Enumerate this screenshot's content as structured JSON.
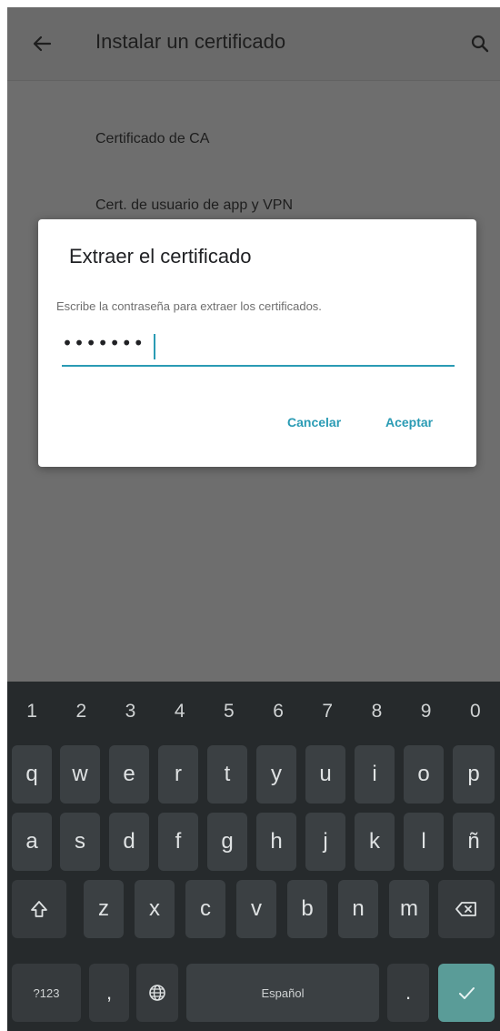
{
  "appbar": {
    "title": "Instalar un certificado",
    "back_icon": "arrow-back-icon",
    "search_icon": "search-icon"
  },
  "list": {
    "items": [
      {
        "label": "Certificado de CA"
      },
      {
        "label": "Cert. de usuario de app y VPN"
      }
    ]
  },
  "dialog": {
    "title": "Extraer el certificado",
    "message": "Escribe la contraseña para extraer los certificados.",
    "password_masked": "•••••••",
    "cancel_label": "Cancelar",
    "accept_label": "Aceptar"
  },
  "keyboard": {
    "numbers": [
      "1",
      "2",
      "3",
      "4",
      "5",
      "6",
      "7",
      "8",
      "9",
      "0"
    ],
    "row1": [
      "q",
      "w",
      "e",
      "r",
      "t",
      "y",
      "u",
      "i",
      "o",
      "p"
    ],
    "row2": [
      "a",
      "s",
      "d",
      "f",
      "g",
      "h",
      "j",
      "k",
      "l",
      "ñ"
    ],
    "row3": [
      "z",
      "x",
      "c",
      "v",
      "b",
      "n",
      "m"
    ],
    "symbols_label": "?123",
    "comma": ",",
    "space_label": "Español",
    "period": ".",
    "shift_icon": "shift-icon",
    "backspace_icon": "backspace-icon",
    "globe_icon": "globe-icon",
    "enter_icon": "checkmark-icon"
  },
  "colors": {
    "accent": "#2a9bb4",
    "scrim": "#6e6e6e",
    "keyboard_bg": "#262a2c",
    "key_bg": "#3b4043",
    "enter_key": "#5a9c98"
  }
}
